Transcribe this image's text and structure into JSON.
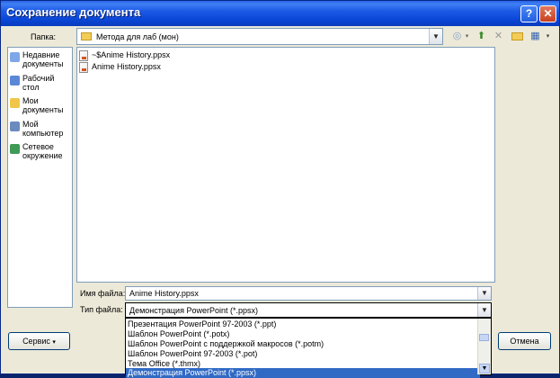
{
  "window": {
    "title": "Сохранение документа",
    "help_button": "?",
    "close_button": "✕"
  },
  "folder": {
    "label": "Папка:",
    "value": "Метода для лаб (мон)"
  },
  "toolbar": {
    "icons": [
      "back-icon",
      "up-folder-icon",
      "delete-icon",
      "new-folder-icon",
      "views-icon"
    ]
  },
  "places": [
    {
      "label": "Недавние документы",
      "icon": "recent-documents-icon"
    },
    {
      "label": "Рабочий стол",
      "icon": "desktop-icon"
    },
    {
      "label": "Мои документы",
      "icon": "my-documents-icon"
    },
    {
      "label": "Мой компьютер",
      "icon": "my-computer-icon"
    },
    {
      "label": "Сетевое окружение",
      "icon": "network-icon"
    }
  ],
  "files": [
    {
      "name": "~$Anime History.ppsx"
    },
    {
      "name": "Anime History.ppsx"
    }
  ],
  "filename": {
    "label": "Имя файла:",
    "value": "Anime History.ppsx"
  },
  "filetype": {
    "label": "Тип файла:",
    "value": "Демонстрация PowerPoint (*.ppsx)",
    "options": [
      "Презентация PowerPoint 97-2003 (*.ppt)",
      "Шаблон PowerPoint (*.potx)",
      "Шаблон PowerPoint с поддержкой макросов (*.potm)",
      "Шаблон PowerPoint 97-2003 (*.pot)",
      "Тема Office (*.thmx)",
      "Демонстрация PowerPoint (*.ppsx)"
    ]
  },
  "buttons": {
    "service": "Сервис",
    "cancel": "Отмена"
  }
}
